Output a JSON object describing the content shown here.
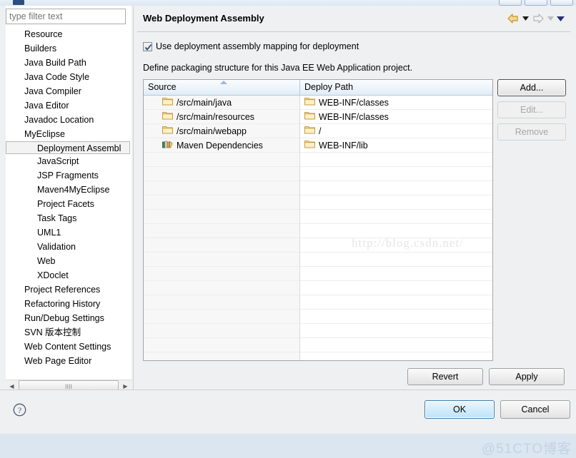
{
  "window": {
    "titlebar_buttons": [
      "minimize",
      "maximize",
      "close"
    ]
  },
  "sidebar": {
    "filter": {
      "value": "",
      "placeholder": "type filter text"
    },
    "items": [
      {
        "label": "Resource",
        "level": 1,
        "selected": false
      },
      {
        "label": "Builders",
        "level": 1,
        "selected": false
      },
      {
        "label": "Java Build Path",
        "level": 1,
        "selected": false
      },
      {
        "label": "Java Code Style",
        "level": 1,
        "selected": false
      },
      {
        "label": "Java Compiler",
        "level": 1,
        "selected": false
      },
      {
        "label": "Java Editor",
        "level": 1,
        "selected": false
      },
      {
        "label": "Javadoc Location",
        "level": 1,
        "selected": false
      },
      {
        "label": "MyEclipse",
        "level": 1,
        "selected": false
      },
      {
        "label": "Deployment Assembl",
        "level": 2,
        "selected": true
      },
      {
        "label": "JavaScript",
        "level": 2,
        "selected": false
      },
      {
        "label": "JSP Fragments",
        "level": 2,
        "selected": false
      },
      {
        "label": "Maven4MyEclipse",
        "level": 2,
        "selected": false
      },
      {
        "label": "Project Facets",
        "level": 2,
        "selected": false
      },
      {
        "label": "Task Tags",
        "level": 2,
        "selected": false
      },
      {
        "label": "UML1",
        "level": 2,
        "selected": false
      },
      {
        "label": "Validation",
        "level": 2,
        "selected": false
      },
      {
        "label": "Web",
        "level": 2,
        "selected": false
      },
      {
        "label": "XDoclet",
        "level": 2,
        "selected": false
      },
      {
        "label": "Project References",
        "level": 1,
        "selected": false
      },
      {
        "label": "Refactoring History",
        "level": 1,
        "selected": false
      },
      {
        "label": "Run/Debug Settings",
        "level": 1,
        "selected": false
      },
      {
        "label": "SVN 版本控制",
        "level": 1,
        "selected": false
      },
      {
        "label": "Web Content Settings",
        "level": 1,
        "selected": false
      },
      {
        "label": "Web Page Editor",
        "level": 1,
        "selected": false
      }
    ],
    "hscroll": {
      "left_arrow": "◀",
      "right_arrow": "▶",
      "grip": "IIII"
    }
  },
  "page": {
    "title": "Web Deployment Assembly",
    "nav": {
      "back": "back-arrow",
      "back_menu": "back-dropdown",
      "forward": "forward-arrow",
      "forward_menu": "forward-dropdown",
      "view_menu": "view-menu"
    },
    "checkbox": {
      "label": "Use deployment assembly mapping for deployment",
      "checked": true
    },
    "description": "Define packaging structure for this Java EE Web Application project.",
    "table": {
      "columns": [
        "Source",
        "Deploy Path"
      ],
      "sorted_column": "Source",
      "sort_direction": "ascending",
      "rows": [
        {
          "source": "/src/main/java",
          "source_icon": "folder-icon",
          "deploy": "WEB-INF/classes",
          "deploy_icon": "folder-icon"
        },
        {
          "source": "/src/main/resources",
          "source_icon": "folder-icon",
          "deploy": "WEB-INF/classes",
          "deploy_icon": "folder-icon"
        },
        {
          "source": "/src/main/webapp",
          "source_icon": "folder-icon",
          "deploy": "/",
          "deploy_icon": "folder-icon"
        },
        {
          "source": "Maven Dependencies",
          "source_icon": "library-icon",
          "deploy": "WEB-INF/lib",
          "deploy_icon": "folder-icon"
        }
      ],
      "empty_row_count": 15
    },
    "side_buttons": [
      {
        "label": "Add...",
        "enabled": true,
        "focused": true
      },
      {
        "label": "Edit...",
        "enabled": false,
        "focused": false
      },
      {
        "label": "Remove",
        "enabled": false,
        "focused": false
      }
    ],
    "bottom_buttons": [
      {
        "label": "Revert",
        "enabled": true
      },
      {
        "label": "Apply",
        "enabled": true
      }
    ]
  },
  "footer": {
    "help_icon": "help-icon",
    "buttons": [
      {
        "label": "OK",
        "default": true
      },
      {
        "label": "Cancel",
        "default": false
      }
    ]
  },
  "watermarks": {
    "center": "http://blog.csdn.net/",
    "bottom_right": "@51CTO博客"
  },
  "colors": {
    "dialog_background": "#eff0f1",
    "desktop_background": "#dce6f1",
    "table_header": "#e1ecf6",
    "default_button": "#bfe3f8",
    "folder_icon": "#f3ce8a",
    "back_arrow": "#e8b63c"
  }
}
